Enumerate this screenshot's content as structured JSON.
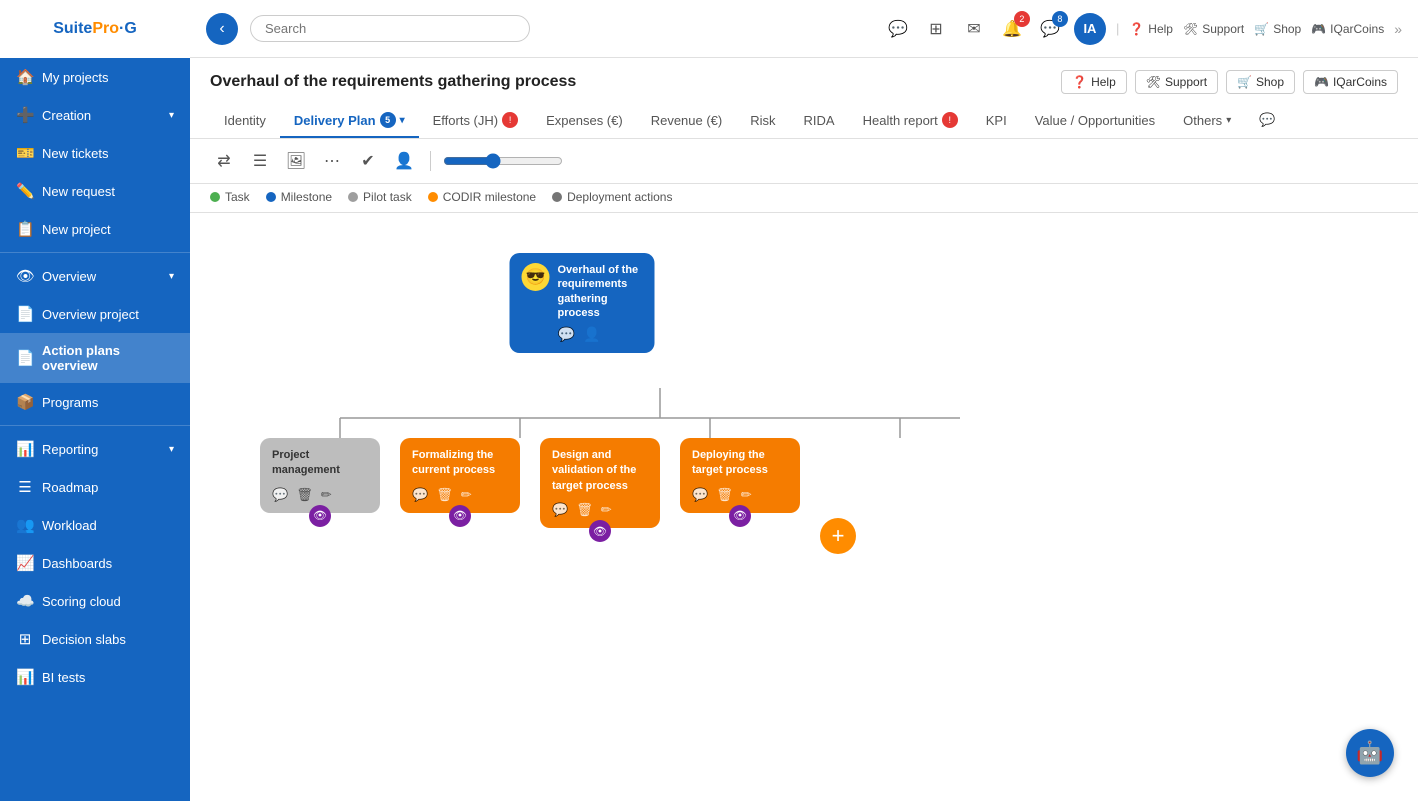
{
  "sidebar": {
    "logo": "SuitePro·G",
    "items": [
      {
        "id": "my-projects",
        "label": "My projects",
        "icon": "🏠",
        "hasArrow": false
      },
      {
        "id": "creation",
        "label": "Creation",
        "icon": "➕",
        "hasArrow": true
      },
      {
        "id": "new-tickets",
        "label": "New tickets",
        "icon": "🎫",
        "hasArrow": false
      },
      {
        "id": "new-request",
        "label": "New request",
        "icon": "✏️",
        "hasArrow": false
      },
      {
        "id": "new-project",
        "label": "New project",
        "icon": "📋",
        "hasArrow": false
      },
      {
        "id": "overview",
        "label": "Overview",
        "icon": "👁",
        "hasArrow": true
      },
      {
        "id": "overview-project",
        "label": "Overview project",
        "icon": "📄",
        "hasArrow": false
      },
      {
        "id": "action-plans",
        "label": "Action plans overview",
        "icon": "📄",
        "hasArrow": false
      },
      {
        "id": "programs",
        "label": "Programs",
        "icon": "📦",
        "hasArrow": false
      },
      {
        "id": "reporting",
        "label": "Reporting",
        "icon": "📊",
        "hasArrow": true
      },
      {
        "id": "roadmap",
        "label": "Roadmap",
        "icon": "☰",
        "hasArrow": false
      },
      {
        "id": "workload",
        "label": "Workload",
        "icon": "👥",
        "hasArrow": false
      },
      {
        "id": "dashboards",
        "label": "Dashboards",
        "icon": "📈",
        "hasArrow": false
      },
      {
        "id": "scoring-cloud",
        "label": "Scoring cloud",
        "icon": "☁️",
        "hasArrow": false
      },
      {
        "id": "decision-slabs",
        "label": "Decision slabs",
        "icon": "⊞",
        "hasArrow": false
      },
      {
        "id": "bi-tests",
        "label": "BI tests",
        "icon": "📊",
        "hasArrow": false
      }
    ]
  },
  "topbar": {
    "search_placeholder": "Search",
    "notifications": {
      "bell_count": "2",
      "chat_count": "8"
    },
    "avatar": "IA",
    "help_label": "Help",
    "support_label": "Support",
    "shop_label": "Shop",
    "iqarcoins_label": "IQarCoins"
  },
  "page": {
    "title": "Overhaul of the requirements gathering process",
    "tabs": [
      {
        "id": "identity",
        "label": "Identity",
        "badge": null,
        "active": false
      },
      {
        "id": "delivery-plan",
        "label": "Delivery Plan",
        "badge": "5",
        "badge_color": "blue",
        "active": true,
        "hasArrow": true
      },
      {
        "id": "efforts",
        "label": "Efforts (JH)",
        "badge": "!",
        "badge_color": "red",
        "active": false
      },
      {
        "id": "expenses",
        "label": "Expenses (€)",
        "badge": null,
        "active": false
      },
      {
        "id": "revenue",
        "label": "Revenue (€)",
        "badge": null,
        "active": false
      },
      {
        "id": "risk",
        "label": "Risk",
        "badge": null,
        "active": false
      },
      {
        "id": "rida",
        "label": "RIDA",
        "badge": null,
        "active": false
      },
      {
        "id": "health-report",
        "label": "Health report",
        "badge": "!",
        "badge_color": "red",
        "active": false
      },
      {
        "id": "kpi",
        "label": "KPI",
        "badge": null,
        "active": false
      },
      {
        "id": "value-opportunities",
        "label": "Value / Opportunities",
        "badge": null,
        "active": false
      },
      {
        "id": "others",
        "label": "Others",
        "badge": null,
        "active": false,
        "hasArrow": true
      },
      {
        "id": "chat",
        "label": "💬",
        "badge": null,
        "active": false
      }
    ]
  },
  "legend": {
    "items": [
      {
        "label": "Task",
        "color": "#4caf50"
      },
      {
        "label": "Milestone",
        "color": "#1565c0"
      },
      {
        "label": "Pilot task",
        "color": "#9e9e9e"
      },
      {
        "label": "CODIR milestone",
        "color": "#ff8c00"
      },
      {
        "label": "Deployment actions",
        "color": "#757575"
      }
    ]
  },
  "tree": {
    "root": {
      "title": "Overhaul of the requirements gathering process",
      "avatar": "😎"
    },
    "children": [
      {
        "id": "project-mgmt",
        "title": "Project management",
        "color": "gray"
      },
      {
        "id": "formalizing",
        "title": "Formalizing the current process",
        "color": "orange"
      },
      {
        "id": "design-validation",
        "title": "Design and validation of the target process",
        "color": "orange"
      },
      {
        "id": "deploying",
        "title": "Deploying the target process",
        "color": "orange"
      }
    ]
  },
  "chatbot_icon": "🤖"
}
